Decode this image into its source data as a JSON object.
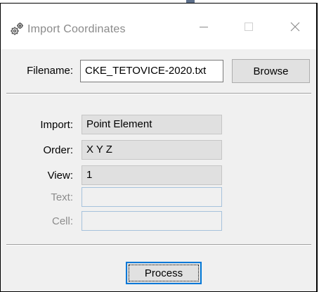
{
  "window": {
    "title": "Import Coordinates",
    "app_icon": "gear-cog-icon",
    "controls": {
      "minimize_icon": "minimize-icon",
      "maximize_icon": "maximize-icon",
      "close_icon": "close-icon"
    }
  },
  "file": {
    "label": "Filename:",
    "value": "CKE_TETOVICE-2020.txt",
    "browse_label": "Browse"
  },
  "options": {
    "import": {
      "label": "Import:",
      "value": "Point Element"
    },
    "order": {
      "label": "Order:",
      "value": "X Y Z"
    },
    "view": {
      "label": "View:",
      "value": "1"
    },
    "text": {
      "label": "Text:",
      "value": ""
    },
    "cell": {
      "label": "Cell:",
      "value": ""
    }
  },
  "actions": {
    "process_label": "Process"
  },
  "colors": {
    "dialog_bg": "#f0f0f0",
    "title_text": "#8a8a8a",
    "focus_border": "#0078d7",
    "disabled_border": "#a6c2dc"
  }
}
